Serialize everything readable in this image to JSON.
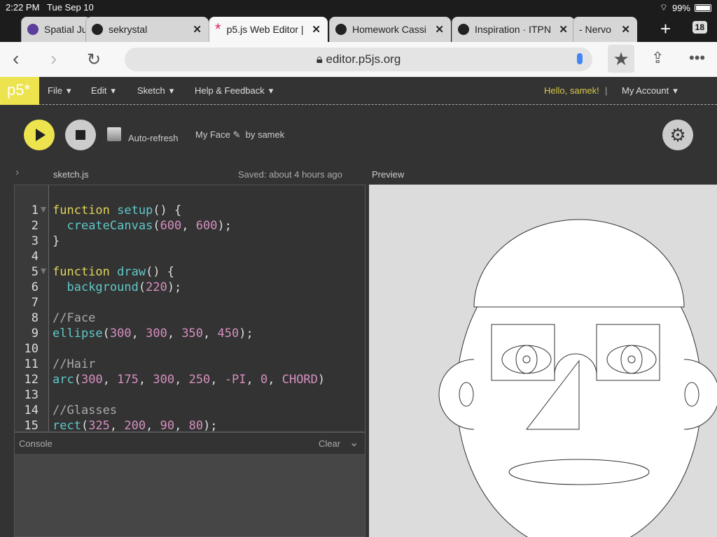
{
  "status": {
    "time": "2:22 PM",
    "date": "Tue Sep 10",
    "battery": "99%",
    "battery_level": 0.99
  },
  "tabs": [
    {
      "label": "Spatial Ju",
      "icon": "itp-icon"
    },
    {
      "label": "sekrystal",
      "icon": "github-icon"
    },
    {
      "label": "p5.js Web Editor |",
      "icon": "p5-asterisk-icon",
      "active": true
    },
    {
      "label": "Homework Cassi",
      "icon": "github-icon"
    },
    {
      "label": "Inspiration · ITPN",
      "icon": "github-icon"
    },
    {
      "label": "- Nervo",
      "icon": ""
    }
  ],
  "tab_count": "18",
  "url": "editor.p5js.org",
  "app": {
    "logo": "p5*",
    "menu": [
      "File",
      "Edit",
      "Sketch",
      "Help & Feedback"
    ],
    "hello": "Hello, samek!",
    "separator": "|",
    "account": "My Account"
  },
  "toolbar": {
    "auto_refresh": "Auto-refresh",
    "sketch_name": "My Face",
    "by": "by samek"
  },
  "editor": {
    "filename": "sketch.js",
    "saved": "Saved: about 4 hours ago",
    "preview_label": "Preview",
    "lines": [
      [
        [
          "kw",
          "function "
        ],
        [
          "fn",
          "setup"
        ],
        [
          "pl",
          "() {"
        ]
      ],
      [
        [
          "pl",
          "  "
        ],
        [
          "fn",
          "createCanvas"
        ],
        [
          "pl",
          "("
        ],
        [
          "num",
          "600"
        ],
        [
          "pl",
          ", "
        ],
        [
          "num",
          "600"
        ],
        [
          "pl",
          ");"
        ]
      ],
      [
        [
          "pl",
          "}"
        ]
      ],
      [],
      [
        [
          "kw",
          "function "
        ],
        [
          "fn",
          "draw"
        ],
        [
          "pl",
          "() {"
        ]
      ],
      [
        [
          "pl",
          "  "
        ],
        [
          "fn",
          "background"
        ],
        [
          "pl",
          "("
        ],
        [
          "num",
          "220"
        ],
        [
          "pl",
          ");"
        ]
      ],
      [],
      [
        [
          "cm",
          "//Face"
        ]
      ],
      [
        [
          "fn",
          "ellipse"
        ],
        [
          "pl",
          "("
        ],
        [
          "num",
          "300"
        ],
        [
          "pl",
          ", "
        ],
        [
          "num",
          "300"
        ],
        [
          "pl",
          ", "
        ],
        [
          "num",
          "350"
        ],
        [
          "pl",
          ", "
        ],
        [
          "num",
          "450"
        ],
        [
          "pl",
          ");"
        ]
      ],
      [],
      [
        [
          "cm",
          "//Hair"
        ]
      ],
      [
        [
          "fn",
          "arc"
        ],
        [
          "pl",
          "("
        ],
        [
          "num",
          "300"
        ],
        [
          "pl",
          ", "
        ],
        [
          "num",
          "175"
        ],
        [
          "pl",
          ", "
        ],
        [
          "num",
          "300"
        ],
        [
          "pl",
          ", "
        ],
        [
          "num",
          "250"
        ],
        [
          "pl",
          ", "
        ],
        [
          "num",
          "-PI"
        ],
        [
          "pl",
          ", "
        ],
        [
          "num",
          "0"
        ],
        [
          "pl",
          ", "
        ],
        [
          "num",
          "CHORD"
        ],
        [
          "pl",
          ")"
        ]
      ],
      [],
      [
        [
          "cm",
          "//Glasses"
        ]
      ],
      [
        [
          "fn",
          "rect"
        ],
        [
          "pl",
          "("
        ],
        [
          "num",
          "325"
        ],
        [
          "pl",
          ", "
        ],
        [
          "num",
          "200"
        ],
        [
          "pl",
          ", "
        ],
        [
          "num",
          "90"
        ],
        [
          "pl",
          ", "
        ],
        [
          "num",
          "80"
        ],
        [
          "pl",
          ");"
        ]
      ]
    ]
  },
  "console": {
    "label": "Console",
    "clear": "Clear"
  },
  "colors": {
    "accent": "#ede34f",
    "keyword": "#e2d55d",
    "function": "#5fc8c9",
    "number": "#d58fbf"
  }
}
